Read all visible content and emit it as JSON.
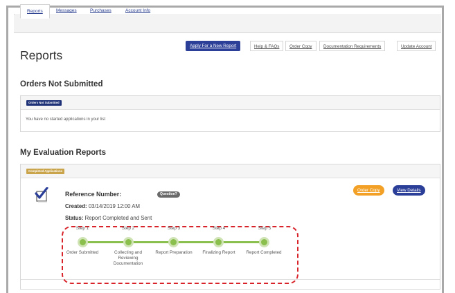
{
  "tabs": [
    "Reports",
    "Messages",
    "Purchases",
    "Account Info"
  ],
  "page_title": "Reports",
  "toolbar": {
    "apply_label": "Apply For a New Report",
    "links": [
      "Help & FAQs",
      "Order Copy",
      "Documentation Requirements",
      "Update Account"
    ]
  },
  "orders_not_submitted": {
    "heading": "Orders Not Submitted",
    "badge": "Orders Not Submitted",
    "empty_text": "You have no started applications in your list"
  },
  "evaluation_reports": {
    "heading": "My Evaluation Reports",
    "badge": "Completed Applications",
    "reference_label": "Reference Number:",
    "question_label": "Question?",
    "created_label": "Created:",
    "created_value": "03/14/2019 12:00 AM",
    "status_label": "Status:",
    "status_value": "Report Completed and Sent",
    "order_copy_label": "Order Copy",
    "view_details_label": "View Details"
  },
  "steps": [
    {
      "num": "Step 1",
      "label": "Order Submitted"
    },
    {
      "num": "Step 2",
      "label": "Collecting and Reviewing Documentation"
    },
    {
      "num": "Step 3",
      "label": "Report Preparation"
    },
    {
      "num": "Step 4",
      "label": "Finalizing Report"
    },
    {
      "num": "Step 5",
      "label": "Report Completed"
    }
  ],
  "colors": {
    "primary_blue": "#2b3f99",
    "accent_orange": "#f2a126",
    "progress_green": "#8bbf4d",
    "highlight_red": "#d8232a",
    "badge_gold": "#c9a44b",
    "badge_navy": "#1f3278"
  },
  "icons": {
    "completed": "checkbox-check-icon"
  }
}
